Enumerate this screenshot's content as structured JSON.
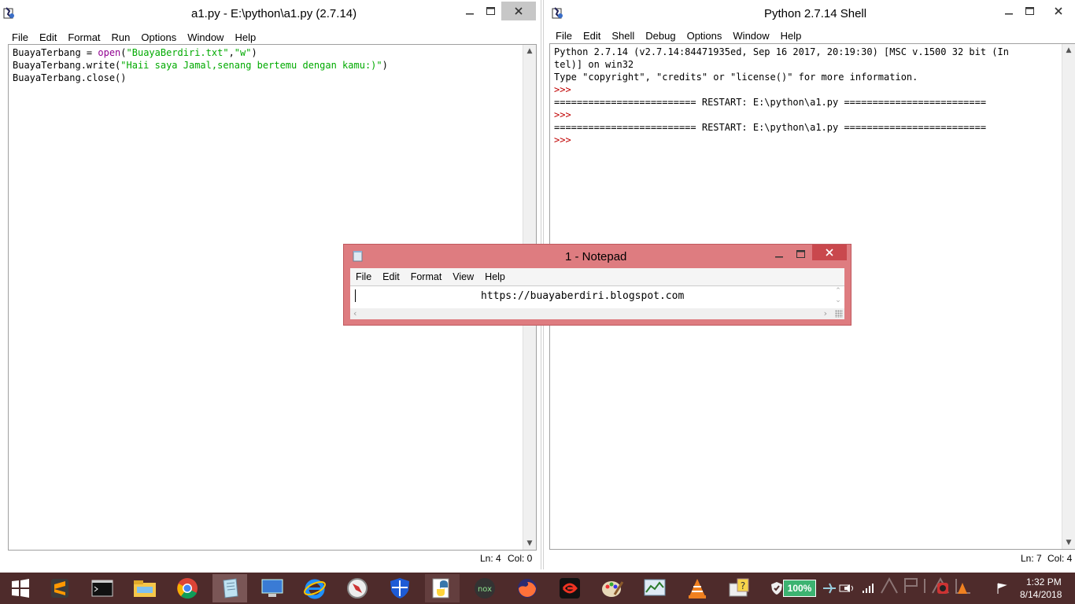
{
  "editor_window": {
    "title": "a1.py - E:\\python\\a1.py (2.7.14)",
    "menu": [
      "File",
      "Edit",
      "Format",
      "Run",
      "Options",
      "Window",
      "Help"
    ],
    "code_lines": [
      [
        {
          "t": "BuayaTerbang = ",
          "c": "plain"
        },
        {
          "t": "open",
          "c": "kw"
        },
        {
          "t": "(",
          "c": "plain"
        },
        {
          "t": "\"BuayaBerdiri.txt\"",
          "c": "str"
        },
        {
          "t": ",",
          "c": "plain"
        },
        {
          "t": "\"w\"",
          "c": "str"
        },
        {
          "t": ")",
          "c": "plain"
        }
      ],
      [
        {
          "t": "BuayaTerbang.write(",
          "c": "plain"
        },
        {
          "t": "\"Haii saya Jamal,senang bertemu dengan kamu:)\"",
          "c": "str"
        },
        {
          "t": ")",
          "c": "plain"
        }
      ],
      [
        {
          "t": "BuayaTerbang.close()",
          "c": "plain"
        }
      ]
    ],
    "status": {
      "ln": "Ln: 4",
      "col": "Col: 0"
    }
  },
  "shell_window": {
    "title": "Python 2.7.14 Shell",
    "menu": [
      "File",
      "Edit",
      "Shell",
      "Debug",
      "Options",
      "Window",
      "Help"
    ],
    "lines": [
      {
        "t": "Python 2.7.14 (v2.7.14:84471935ed, Sep 16 2017, 20:19:30) [MSC v.1500 32 bit (In",
        "c": "plain"
      },
      {
        "t": "tel)] on win32",
        "c": "plain"
      },
      {
        "t": "Type \"copyright\", \"credits\" or \"license()\" for more information.",
        "c": "plain"
      },
      {
        "t": ">>> ",
        "c": "prompt"
      },
      {
        "t": "========================= RESTART: E:\\python\\a1.py =========================",
        "c": "plain"
      },
      {
        "t": ">>> ",
        "c": "prompt"
      },
      {
        "t": "========================= RESTART: E:\\python\\a1.py =========================",
        "c": "plain"
      },
      {
        "t": ">>> ",
        "c": "prompt"
      }
    ],
    "status": {
      "ln": "Ln: 7",
      "col": "Col: 4"
    }
  },
  "notepad": {
    "title": "1 - Notepad",
    "menu": [
      "File",
      "Edit",
      "Format",
      "View",
      "Help"
    ],
    "content": "https://buayaberdiri.blogspot.com"
  },
  "taskbar": {
    "items": [
      {
        "name": "start-button-icon",
        "state": "none"
      },
      {
        "name": "sublime-text-icon",
        "state": "none"
      },
      {
        "name": "command-prompt-icon",
        "state": "none"
      },
      {
        "name": "file-explorer-icon",
        "state": "none"
      },
      {
        "name": "chrome-icon",
        "state": "none"
      },
      {
        "name": "notepad-icon",
        "state": "active"
      },
      {
        "name": "remote-desktop-icon",
        "state": "none"
      },
      {
        "name": "internet-explorer-icon",
        "state": "none"
      },
      {
        "name": "compass-icon",
        "state": "none"
      },
      {
        "name": "windows-defender-icon",
        "state": "none"
      },
      {
        "name": "python-idle-icon",
        "state": "running"
      },
      {
        "name": "nox-player-icon",
        "state": "none"
      },
      {
        "name": "firefox-icon",
        "state": "none"
      },
      {
        "name": "garena-icon",
        "state": "none"
      },
      {
        "name": "paint-icon",
        "state": "none"
      },
      {
        "name": "performance-monitor-icon",
        "state": "none"
      },
      {
        "name": "vlc-icon",
        "state": "none"
      },
      {
        "name": "help-icon",
        "state": "none"
      }
    ],
    "battery": "100%",
    "time": "1:32 PM",
    "date": "8/14/2018",
    "colors": {
      "taskbar": "#4e2b2b",
      "notepad_frame": "#de7c80"
    }
  }
}
